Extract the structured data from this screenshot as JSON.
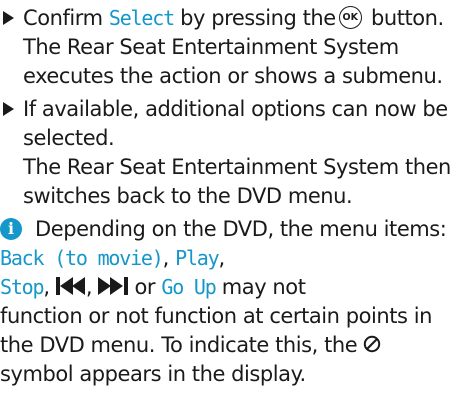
{
  "step1": {
    "prefix": "Confirm ",
    "select": "Select",
    "middle": " by pressing the",
    "ok": "OK",
    "suffix": " button.",
    "line2": "The Rear Seat Entertainment System",
    "line3": "executes the action or shows a submenu."
  },
  "step2": {
    "line1": "If available, additional options can now be",
    "line2": "selected.",
    "line3": "The Rear Seat Entertainment System then",
    "line4": "switches back to the DVD menu."
  },
  "note": {
    "line1": "Depending on the DVD, the menu items:",
    "back": "Back (to movie)",
    "comma1": ",",
    "play": "Play",
    "comma2": ",",
    "stop": "Stop",
    "comma3": ",",
    "comma4": ",",
    "or": " or ",
    "goup": "Go Up",
    "tail": " may not",
    "line4": "function or not function at certain points in",
    "line5": "the DVD menu. To indicate this, the",
    "line6": "symbol appears in the display."
  },
  "colors": {
    "accent": "#1597c9",
    "text": "#1a1a1a"
  },
  "icons": [
    "bullet-arrow-icon",
    "ok-button-icon",
    "info-icon",
    "skip-back-icon",
    "skip-forward-icon",
    "prohibited-icon"
  ]
}
